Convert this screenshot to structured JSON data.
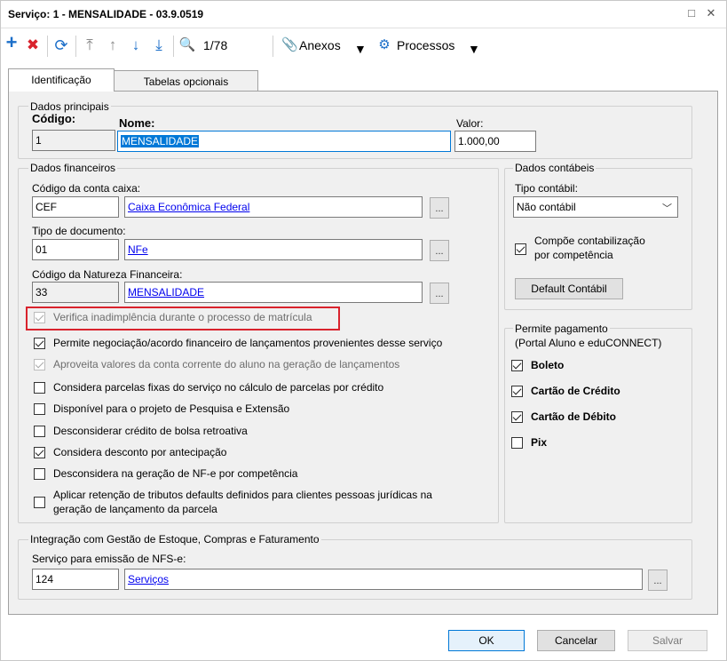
{
  "window": {
    "title": "Serviço: 1 - MENSALIDADE - 03.9.0519",
    "maximize_glyph": "□",
    "close_glyph": "✕"
  },
  "toolbar": {
    "icons": {
      "add": "+",
      "delete": "✖",
      "refresh": "⟳",
      "first": "⤒",
      "prev": "↑",
      "next": "↓",
      "last": "⤓",
      "search": "🔍"
    },
    "record_counter": "1/78",
    "anexos_label": "Anexos",
    "processos_label": "Processos"
  },
  "tabs": [
    {
      "label": "Identificação"
    },
    {
      "label": "Tabelas opcionais"
    }
  ],
  "dados_principais": {
    "title": "Dados principais",
    "codigo_label": "Código:",
    "codigo_value": "1",
    "nome_label": "Nome:",
    "nome_value": "MENSALIDADE",
    "valor_label": "Valor:",
    "valor_value": "1.000,00"
  },
  "dados_financeiros": {
    "title": "Dados financeiros",
    "conta_caixa_label": "Código da conta caixa:",
    "conta_caixa_code": "CEF",
    "conta_caixa_name": "Caixa Econômica Federal",
    "tipo_doc_label": "Tipo de documento:",
    "tipo_doc_code": "01",
    "tipo_doc_name": "NFe",
    "natureza_label": "Código da Natureza Financeira:",
    "natureza_code": "33",
    "natureza_name": "MENSALIDADE",
    "browse": "..."
  },
  "options": [
    {
      "label": "Verifica inadimplência durante o processo de matrícula",
      "checked": true,
      "disabled": true
    },
    {
      "label": "Permite negociação/acordo financeiro de lançamentos provenientes desse serviço",
      "checked": true,
      "disabled": false
    },
    {
      "label": "Aproveita valores da conta corrente do aluno na geração de lançamentos",
      "checked": true,
      "disabled": true
    },
    {
      "label": "Considera parcelas fixas do serviço no cálculo de parcelas por crédito",
      "checked": false,
      "disabled": false
    },
    {
      "label": "Disponível para o projeto de Pesquisa e Extensão",
      "checked": false,
      "disabled": false
    },
    {
      "label": "Desconsiderar crédito de bolsa retroativa",
      "checked": false,
      "disabled": false
    },
    {
      "label": "Considera desconto por antecipação",
      "checked": true,
      "disabled": false
    },
    {
      "label": "Desconsidera na geração de NF-e por competência",
      "checked": false,
      "disabled": false
    },
    {
      "label": "Aplicar retenção de tributos defaults definidos para clientes pessoas jurídicas na",
      "label2": "geração de lançamento da parcela",
      "checked": false,
      "disabled": false
    }
  ],
  "dados_contabeis": {
    "title": "Dados contábeis",
    "tipo_label": "Tipo contábil:",
    "tipo_value": "Não contábil",
    "compoe_line1": "Compõe contabilização",
    "compoe_line2": "por competência",
    "compoe_checked": true,
    "default_button": "Default Contábil"
  },
  "permite_pagamento": {
    "title": "Permite pagamento",
    "subtitle": "(Portal Aluno e eduCONNECT)",
    "items": [
      {
        "label": "Boleto",
        "checked": true
      },
      {
        "label": "Cartão de Crédito",
        "checked": true
      },
      {
        "label": "Cartão de Débito",
        "checked": true
      },
      {
        "label": "Pix",
        "checked": false
      }
    ]
  },
  "integracao": {
    "title": "Integração com Gestão de Estoque, Compras e Faturamento",
    "servico_label": "Serviço para emissão de NFS-e:",
    "servico_code": "124",
    "servico_name": "Serviços"
  },
  "footer": {
    "ok": "OK",
    "cancel": "Cancelar",
    "save": "Salvar"
  },
  "colors": {
    "add": "#1c6fc9",
    "delete": "#d9232d",
    "toolbar_blue": "#1c6fc9",
    "highlight_border": "#d9232d",
    "selection": "#0078d7"
  }
}
